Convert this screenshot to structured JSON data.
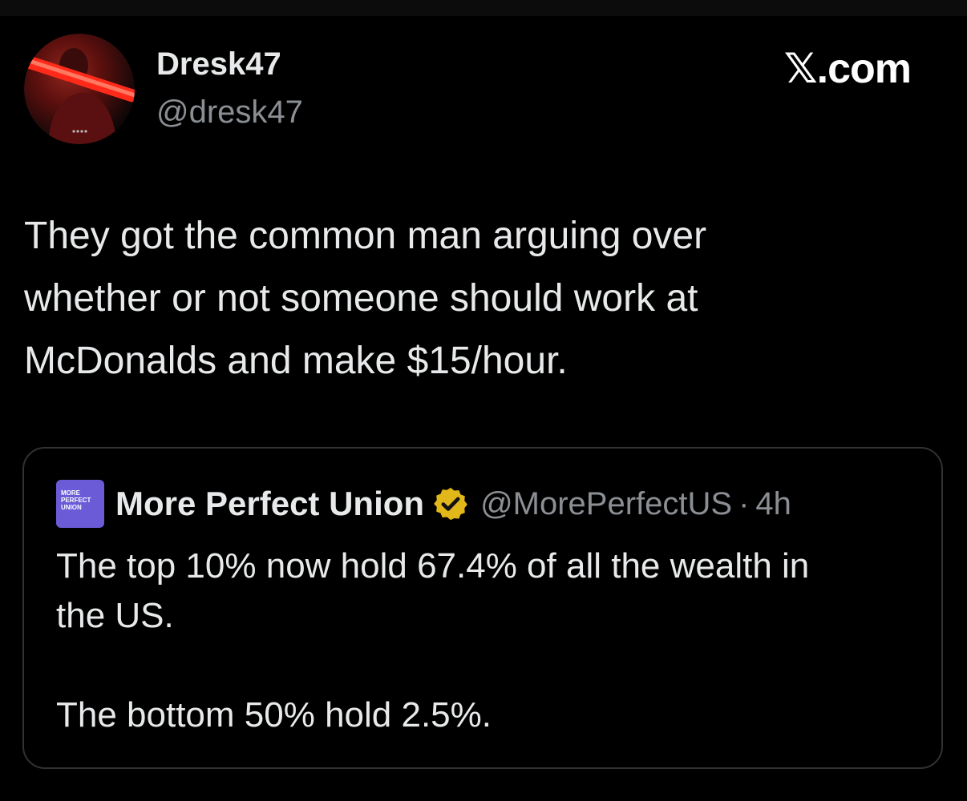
{
  "author": {
    "display_name": "Dresk47",
    "handle": "@dresk47",
    "avatar_icon": "profile-avatar-icon"
  },
  "brand": {
    "label": "𝕏.com"
  },
  "tweet": {
    "lines": [
      "They got the common man arguing over",
      "whether or not someone should work at",
      "McDonalds and make $15/hour."
    ]
  },
  "quote": {
    "logo_text": "MORE\nPERFECT\nUNION",
    "logo_color": "#6b5bd6",
    "name": "More Perfect Union",
    "verified_icon": "verified-badge-icon",
    "verified_color": "#e2b719",
    "handle": "@MorePerfectUS",
    "separator": "·",
    "time": "4h",
    "paragraphs": [
      [
        "The top 10% now hold 67.4% of all the wealth in",
        "the US."
      ],
      [
        "The bottom 50% hold 2.5%."
      ]
    ]
  }
}
